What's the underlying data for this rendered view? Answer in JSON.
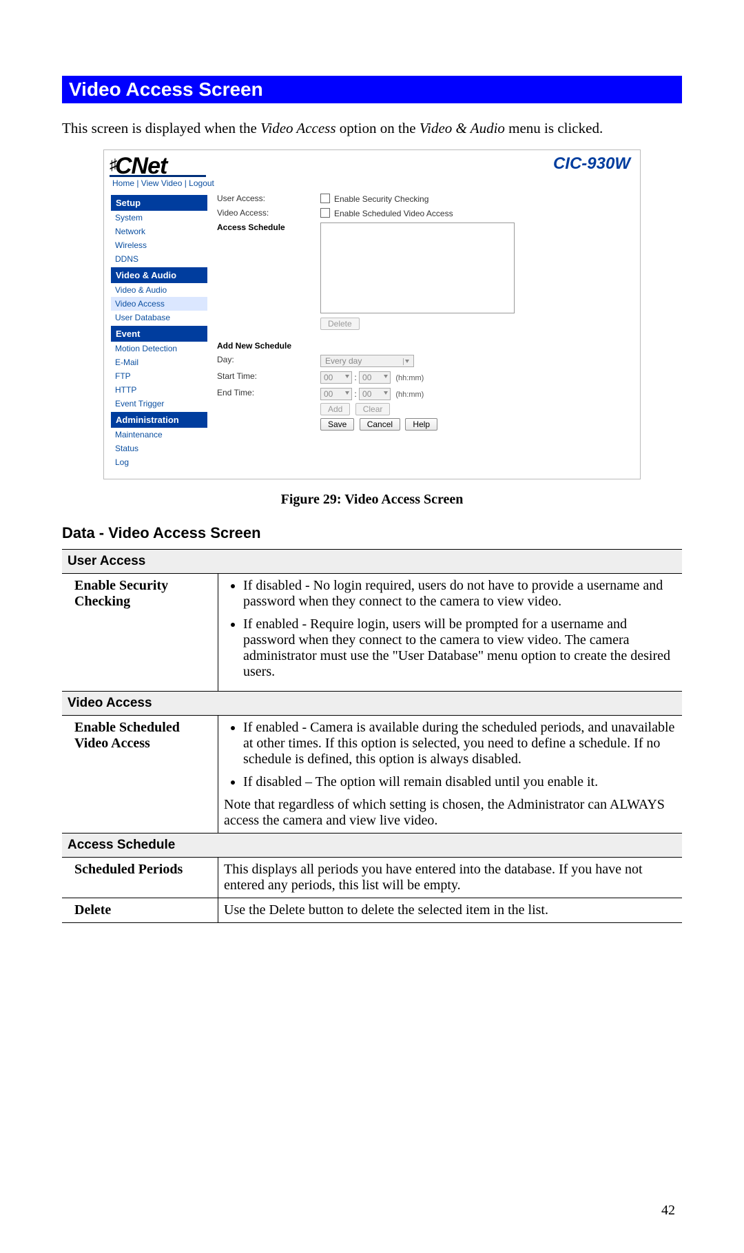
{
  "banner_title": "Video Access Screen",
  "intro_prefix": "This screen is displayed when the ",
  "intro_em1": "Video Access",
  "intro_mid": " option on the ",
  "intro_em2": "Video & Audio",
  "intro_suffix": " menu is clicked.",
  "figure_caption": "Figure 29: Video Access Screen",
  "data_section_title": "Data - Video Access Screen",
  "page_number": "42",
  "shot": {
    "logo_main": "CNet",
    "model": "CIC-930W",
    "top_links": "Home | View Video | Logout",
    "nav": {
      "setup_head": "Setup",
      "setup_items": [
        "System",
        "Network",
        "Wireless",
        "DDNS"
      ],
      "va_head": "Video & Audio",
      "va_items": [
        "Video & Audio",
        "Video Access",
        "User Database"
      ],
      "event_head": "Event",
      "event_items": [
        "Motion Detection",
        "E-Mail",
        "FTP",
        "HTTP",
        "Event Trigger"
      ],
      "admin_head": "Administration",
      "admin_items": [
        "Maintenance",
        "Status",
        "Log"
      ]
    },
    "form": {
      "user_access_label": "User Access:",
      "enable_security": "Enable Security Checking",
      "video_access_label": "Video Access:",
      "enable_scheduled": "Enable Scheduled Video Access",
      "access_schedule_heading": "Access Schedule",
      "delete_btn": "Delete",
      "add_new_heading": "Add New Schedule",
      "day_label": "Day:",
      "day_value": "Every day",
      "start_time_label": "Start Time:",
      "end_time_label": "End Time:",
      "hh_value": "00",
      "mm_value": "00",
      "hhmm_hint": "(hh:mm)",
      "add_btn": "Add",
      "clear_btn": "Clear",
      "save_btn": "Save",
      "cancel_btn": "Cancel",
      "help_btn": "Help"
    }
  },
  "table": {
    "s1": "User Access",
    "s1_r1_key": "Enable Security Checking",
    "s1_r1_b1": "If disabled - No login required, users do not have to provide a username and password when they connect to the camera to view video.",
    "s1_r1_b2": "If enabled - Require login, users will be prompted for a username and password when they connect to the camera to view video. The camera administrator must use the \"User Database\" menu option to create the desired users.",
    "s2": "Video Access",
    "s2_r1_key": "Enable Scheduled Video Access",
    "s2_r1_b1": "If enabled - Camera is available during the scheduled periods, and unavailable at other times. If this option is selected, you need to define a schedule. If no schedule is defined, this option is always disabled.",
    "s2_r1_b2": "If disabled – The option will remain disabled until you enable it.",
    "s2_r1_note": "Note that regardless of which setting is chosen, the Administrator can ALWAYS access the camera and view live video.",
    "s3": "Access Schedule",
    "s3_r1_key": "Scheduled Periods",
    "s3_r1_val": "This displays all periods you have entered into the database. If you have not entered any periods, this list will be empty.",
    "s3_r2_key": "Delete",
    "s3_r2_val": "Use the Delete button to delete the selected item in the list."
  }
}
